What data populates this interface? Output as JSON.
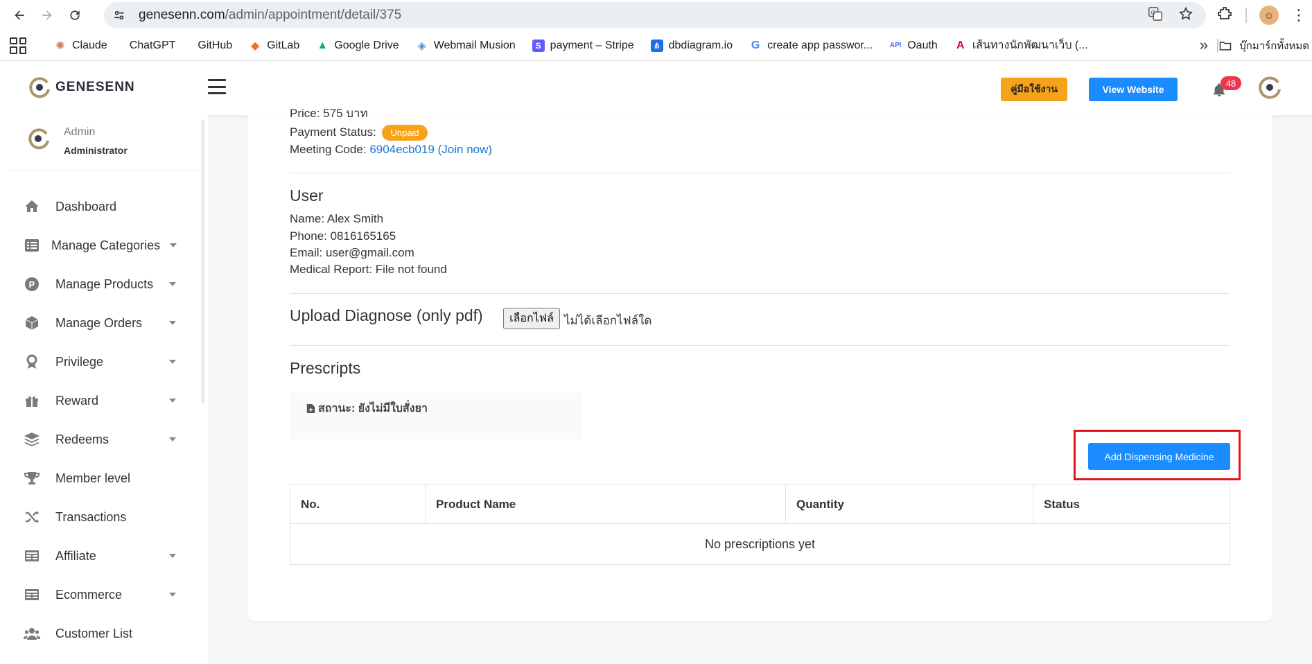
{
  "browser": {
    "url_domain": "genesenn.com",
    "url_path": "/admin/appointment/detail/375"
  },
  "bookmarks": {
    "items": [
      {
        "label": "Claude",
        "icon": "claude-icon",
        "color": "#d97757"
      },
      {
        "label": "ChatGPT",
        "icon": "chatgpt-icon",
        "color": "#1f1f1f"
      },
      {
        "label": "GitHub",
        "icon": "github-icon",
        "color": "#1f1f1f"
      },
      {
        "label": "GitLab",
        "icon": "gitlab-icon",
        "color": "#fc6d26"
      },
      {
        "label": "Google Drive",
        "icon": "google-drive-icon",
        "color": "#1fa463"
      },
      {
        "label": "Webmail Musion",
        "icon": "webmail-icon",
        "color": "#4a90d9"
      },
      {
        "label": "payment – Stripe",
        "icon": "stripe-icon",
        "color": "#635bff"
      },
      {
        "label": "dbdiagram.io",
        "icon": "dbdiagram-icon",
        "color": "#1f6feb"
      },
      {
        "label": "create app passwor...",
        "icon": "google-icon",
        "color": "#4285f4"
      },
      {
        "label": "Oauth",
        "icon": "api-icon",
        "color": "#4a6cf7"
      },
      {
        "label": "เส้นทางนักพัฒนาเว็บ (...",
        "icon": "angular-icon",
        "color": "#dd0031"
      }
    ],
    "more": "»",
    "folder_label": "บุ๊กมาร์กทั้งหมด"
  },
  "header": {
    "logo_text": "GENESENN",
    "manual_button": "คู่มือใช้งาน",
    "view_website_button": "View Website",
    "notification_count": "48"
  },
  "sidebar": {
    "user_role": "Admin",
    "user_name": "Administrator",
    "menu": [
      {
        "label": "Dashboard",
        "icon": "home-icon",
        "has_caret": false
      },
      {
        "label": "Manage Categories",
        "icon": "list-icon",
        "has_caret": true
      },
      {
        "label": "Manage Products",
        "icon": "product-p-icon",
        "has_caret": true
      },
      {
        "label": "Manage Orders",
        "icon": "cube-icon",
        "has_caret": true
      },
      {
        "label": "Privilege",
        "icon": "award-icon",
        "has_caret": true
      },
      {
        "label": "Reward",
        "icon": "gift-icon",
        "has_caret": true
      },
      {
        "label": "Redeems",
        "icon": "layers-icon",
        "has_caret": true
      },
      {
        "label": "Member level",
        "icon": "trophy-icon",
        "has_caret": false
      },
      {
        "label": "Transactions",
        "icon": "shuffle-icon",
        "has_caret": false
      },
      {
        "label": "Affiliate",
        "icon": "card-icon",
        "has_caret": true
      },
      {
        "label": "Ecommerce",
        "icon": "card-icon",
        "has_caret": true
      },
      {
        "label": "Customer List",
        "icon": "users-icon",
        "has_caret": false
      }
    ]
  },
  "appointment": {
    "price_cut": "Price: 575 บาท",
    "payment_status_label": "Payment Status:",
    "payment_status_value": "Unpaid",
    "meeting_code_label": "Meeting Code:",
    "meeting_code_value": "6904ecb019 (Join now)"
  },
  "user_section": {
    "title": "User",
    "name": "Name: Alex Smith",
    "phone": "Phone: 0816165165",
    "email": "Email: user@gmail.com",
    "medical_report": "Medical Report: File not found"
  },
  "upload": {
    "title": "Upload Diagnose (only pdf)",
    "choose_button": "เลือกไฟล์",
    "no_file": "ไม่ได้เลือกไฟล์ใด"
  },
  "prescripts": {
    "title": "Prescripts",
    "status": "สถานะ: ยังไม่มีใบสั่งยา",
    "add_button": "Add Dispensing Medicine",
    "columns": [
      "No.",
      "Product Name",
      "Quantity",
      "Status"
    ],
    "empty_text": "No prescriptions yet"
  },
  "colors": {
    "primary": "#1a8cff",
    "warning": "#f7a21b",
    "badge": "#f0334f",
    "highlight": "#e0161d"
  }
}
